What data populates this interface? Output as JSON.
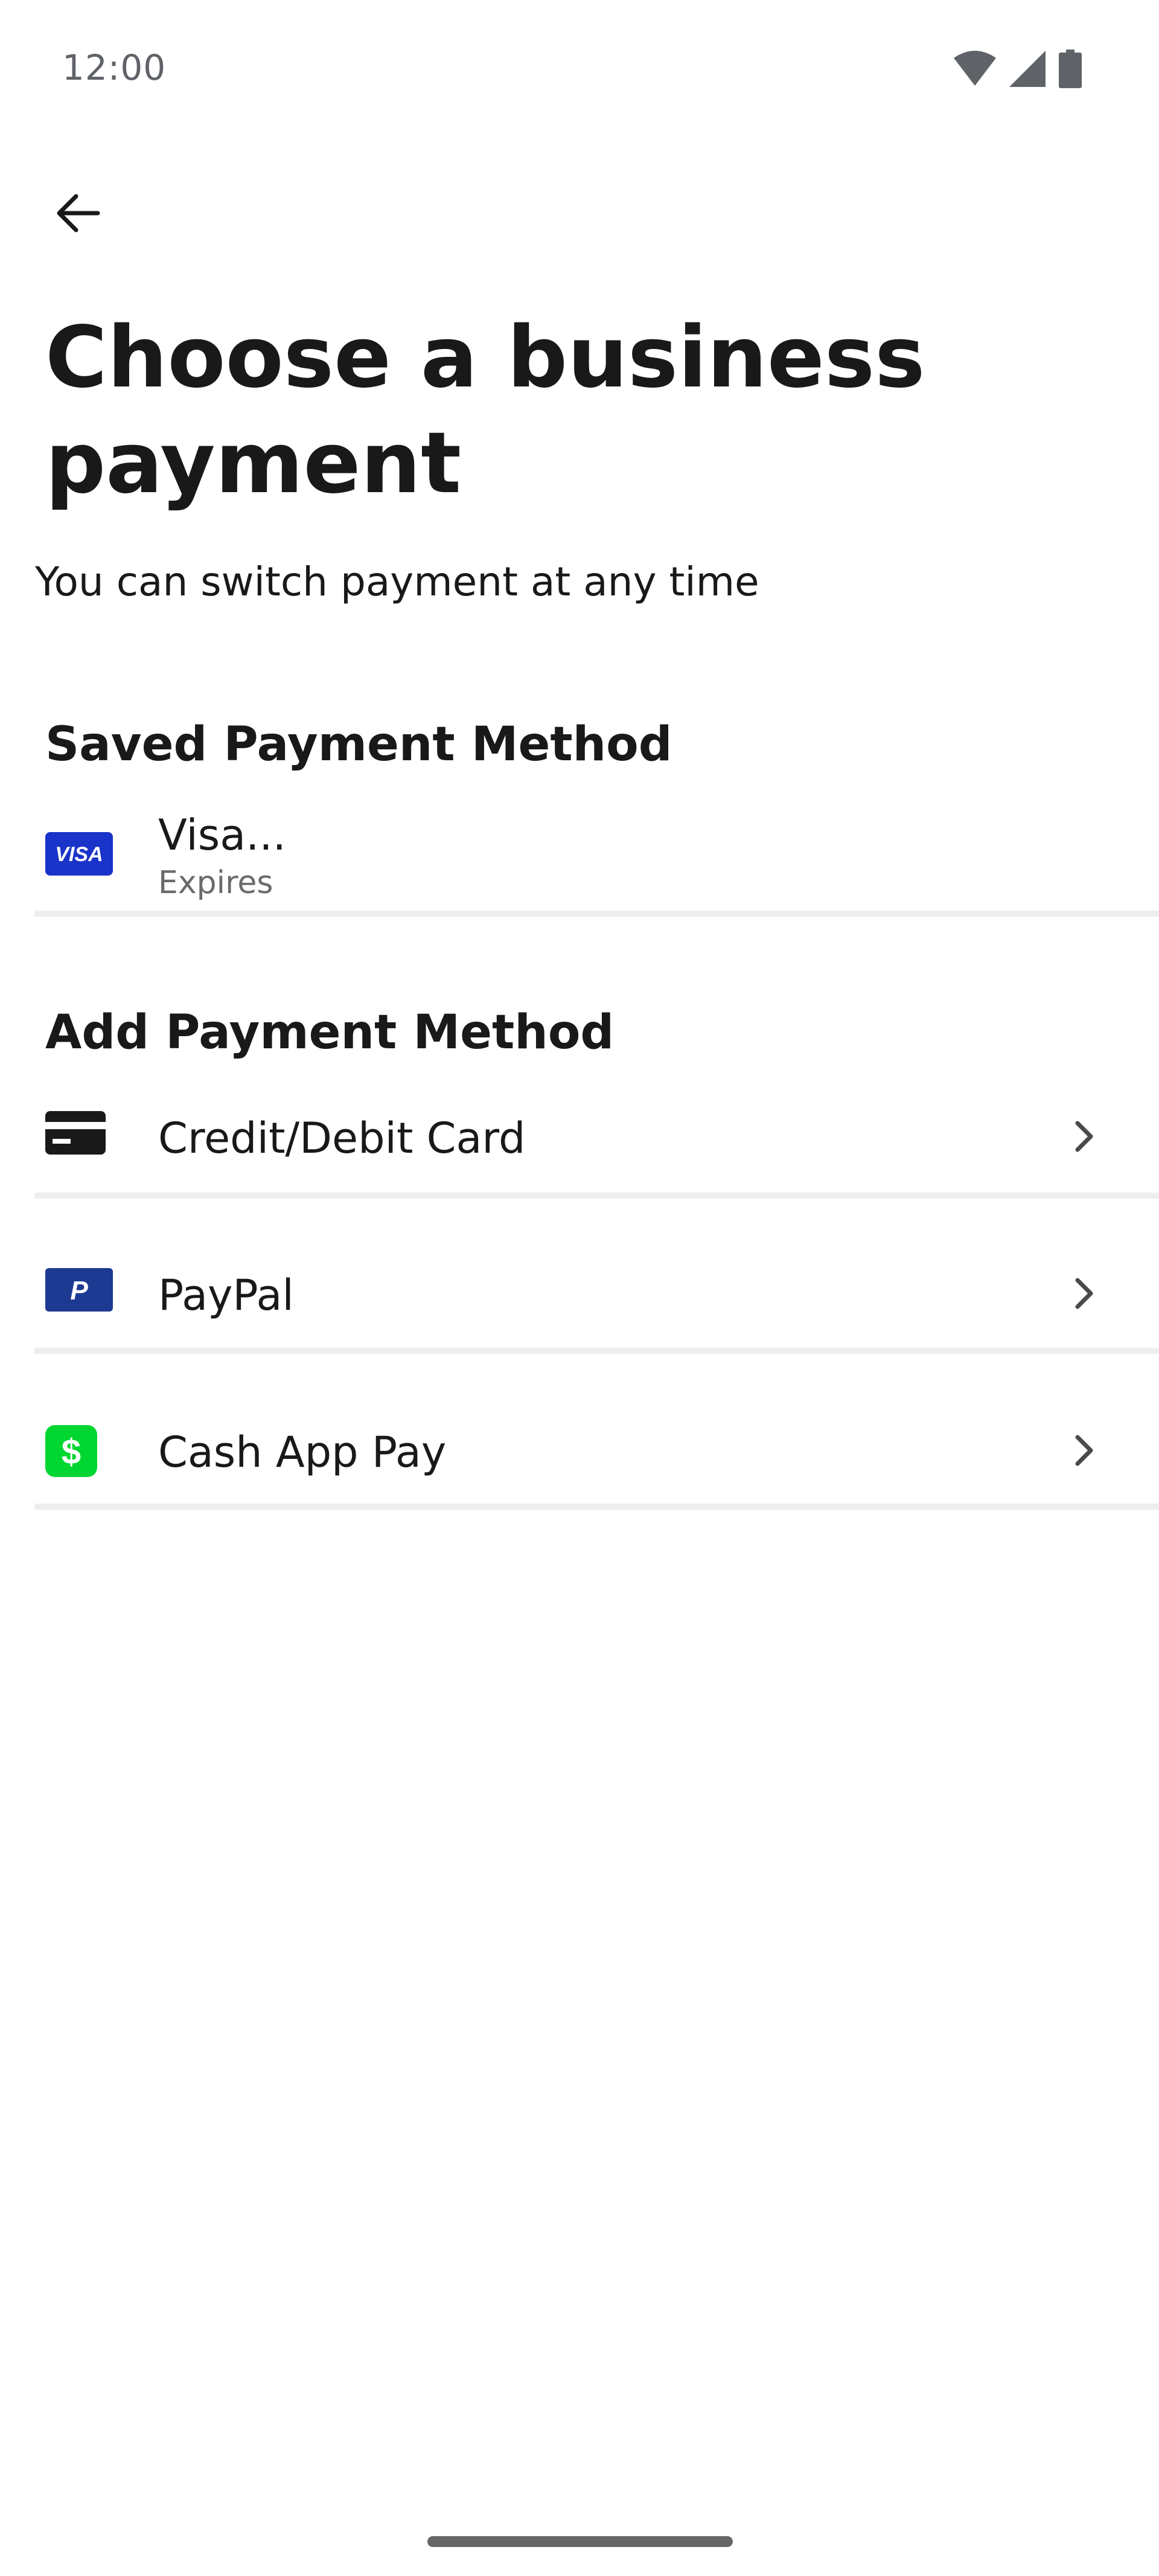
{
  "status_bar": {
    "time": "12:00",
    "icons": [
      "wifi-icon",
      "cellular-signal-icon",
      "battery-icon"
    ]
  },
  "header": {
    "back_icon": "arrow-left-icon",
    "title": "Choose a business payment",
    "subtitle": "You can switch payment at any time"
  },
  "saved_section": {
    "heading": "Saved Payment Method",
    "items": [
      {
        "icon": "visa-card-icon",
        "icon_text": "VISA",
        "title": "Visa...",
        "subtitle": "Expires"
      }
    ]
  },
  "add_section": {
    "heading": "Add Payment Method",
    "items": [
      {
        "icon": "credit-card-icon",
        "label": "Credit/Debit Card",
        "chevron": "chevron-right-icon"
      },
      {
        "icon": "paypal-icon",
        "icon_text": "P",
        "label": "PayPal",
        "chevron": "chevron-right-icon"
      },
      {
        "icon": "cash-app-icon",
        "icon_text": "$",
        "label": "Cash App Pay",
        "chevron": "chevron-right-icon"
      }
    ]
  },
  "colors": {
    "visa_blue": "#1a33c9",
    "paypal_blue": "#1d3a93",
    "cashapp_green": "#00d632",
    "divider": "#eeeeee",
    "text_primary": "#191919",
    "text_secondary": "#6b6b6b"
  }
}
